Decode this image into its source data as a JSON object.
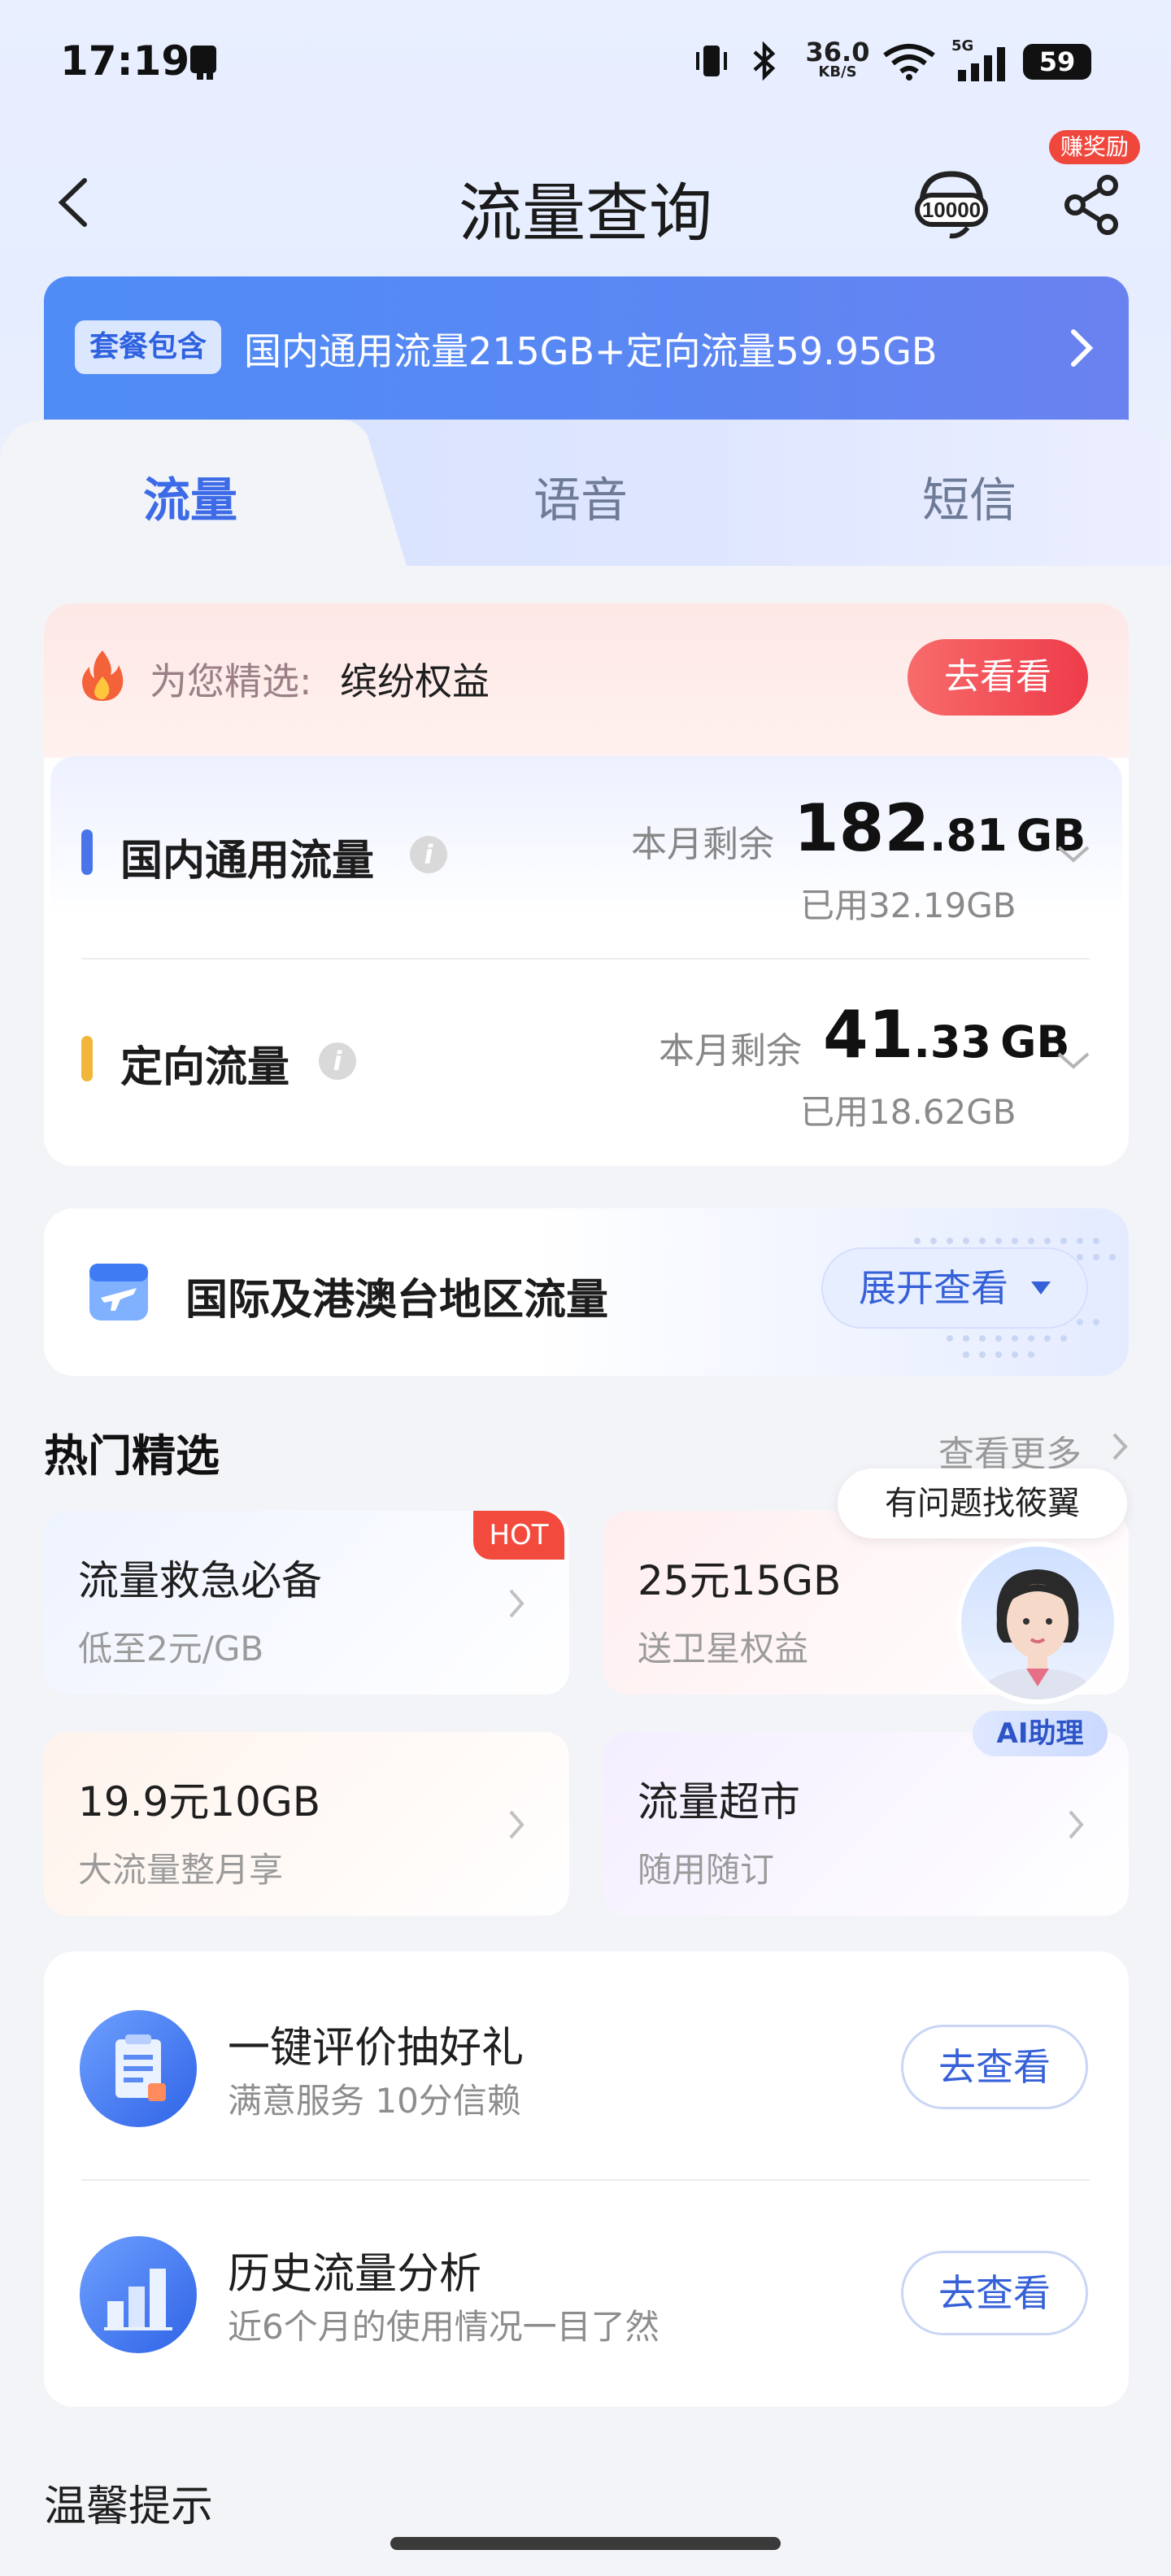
{
  "status_bar": {
    "time": "17:19",
    "net_speed_value": "36.0",
    "net_speed_unit": "KB/S",
    "signal": "5G",
    "battery": "59"
  },
  "header": {
    "title": "流量查询",
    "reward_badge": "赚奖励"
  },
  "plan": {
    "badge": "套餐包含",
    "text": "国内通用流量215GB+定向流量59.95GB"
  },
  "tabs": [
    {
      "label": "流量"
    },
    {
      "label": "语音"
    },
    {
      "label": "短信"
    }
  ],
  "promo": {
    "label": "为您精选:",
    "name": "缤纷权益",
    "button": "去看看"
  },
  "usage": [
    {
      "title": "国内通用流量",
      "remain_label": "本月剩余",
      "remain_int": "182",
      "remain_dec": ".81",
      "unit": "GB",
      "used": "已用32.19GB",
      "color": "#4a74ea"
    },
    {
      "title": "定向流量",
      "remain_label": "本月剩余",
      "remain_int": "41",
      "remain_dec": ".33",
      "unit": "GB",
      "used": "已用18.62GB",
      "color": "#f2b73a"
    }
  ],
  "international": {
    "title": "国际及港澳台地区流量",
    "button": "展开查看"
  },
  "hot": {
    "title": "热门精选",
    "more": "查看更多",
    "hot_badge": "HOT",
    "tiles": [
      {
        "title": "流量救急必备",
        "subtitle": "低至2元/GB"
      },
      {
        "title": "25元15GB",
        "subtitle": "送卫星权益"
      },
      {
        "title": "19.9元10GB",
        "subtitle": "大流量整月享"
      },
      {
        "title": "流量超市",
        "subtitle": "随用随订"
      }
    ]
  },
  "assistant": {
    "bubble": "有问题找筱翼",
    "tag": "AI助理"
  },
  "actions": [
    {
      "title": "一键评价抽好礼",
      "subtitle": "满意服务 10分信赖",
      "button": "去查看"
    },
    {
      "title": "历史流量分析",
      "subtitle": "近6个月的使用情况一目了然",
      "button": "去查看"
    }
  ],
  "tips": {
    "title": "温馨提示"
  },
  "colors": {
    "accent": "#3d6be8",
    "red": "#ee3c4a",
    "hot": "#f24b3e"
  }
}
